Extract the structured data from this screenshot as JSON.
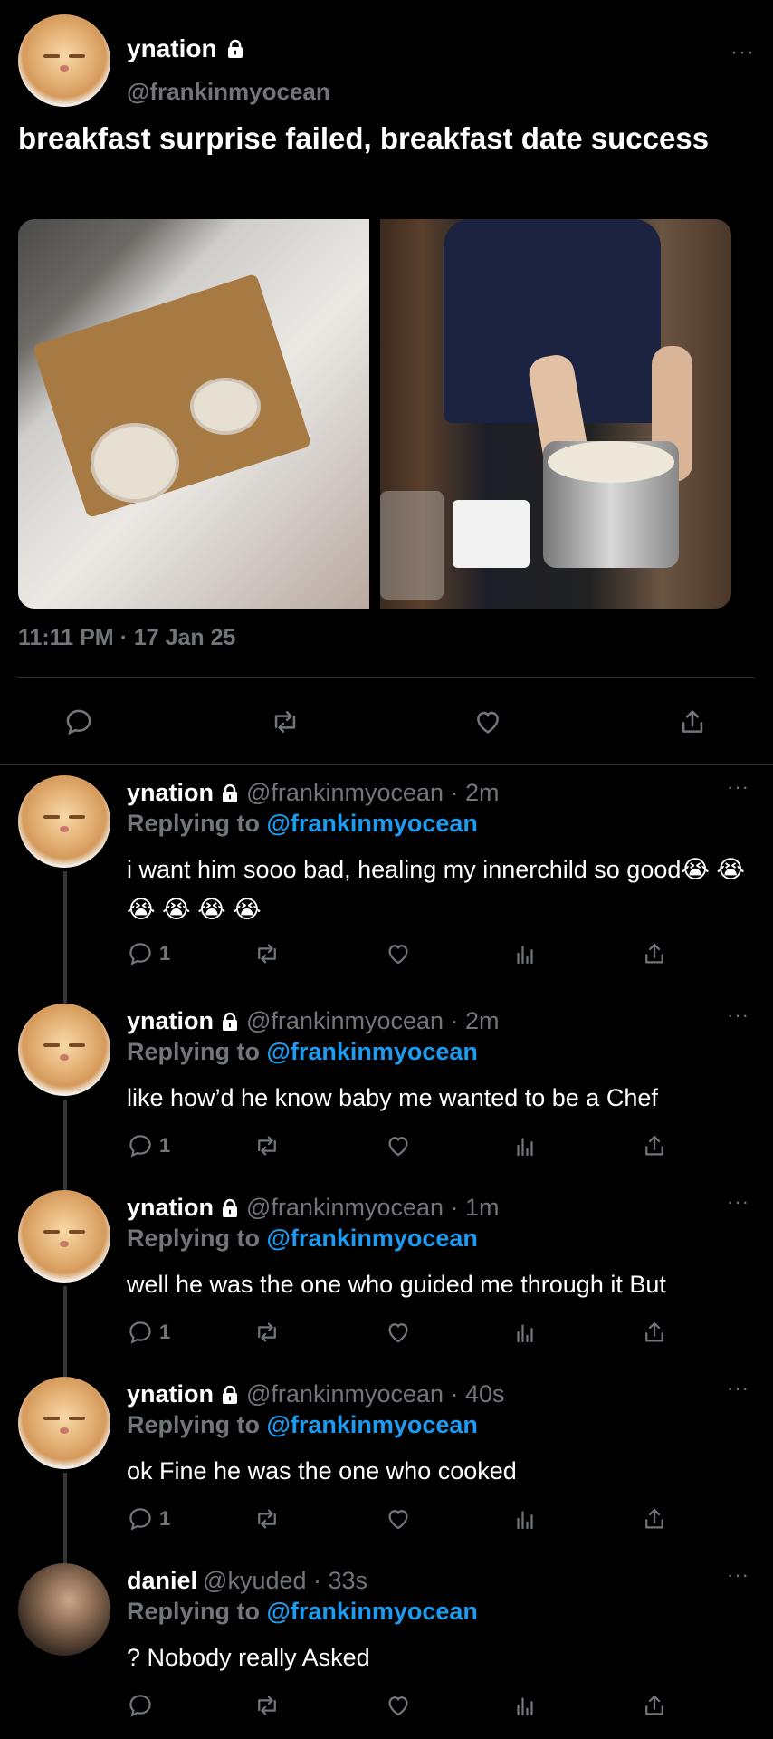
{
  "tweet": {
    "name": "ynation",
    "handle": "@frankinmyocean",
    "more": "···",
    "text": "breakfast surprise failed, breakfast date success",
    "timestamp": "11:11 PM · 17 Jan 25",
    "images": [
      "breakfast-tray-photo",
      "cooking-pot-photo"
    ]
  },
  "replies": [
    {
      "name": "ynation",
      "handle": "@frankinmyocean · 2m",
      "replying_prefix": "Replying to",
      "replying_to": "@frankinmyocean",
      "text": "i want him sooo bad, healing my innerchild so good😭 😭 😭 😭 😭 😭",
      "reply_count": "1",
      "more": "···"
    },
    {
      "name": "ynation",
      "handle": "@frankinmyocean · 2m",
      "replying_prefix": "Replying to",
      "replying_to": "@frankinmyocean",
      "text": "like how’d he know baby me wanted to be a Chef",
      "reply_count": "1",
      "more": "···"
    },
    {
      "name": "ynation",
      "handle": "@frankinmyocean · 1m",
      "replying_prefix": "Replying to",
      "replying_to": "@frankinmyocean",
      "text": "well he was the one who guided me through it But",
      "reply_count": "1",
      "more": "···"
    },
    {
      "name": "ynation",
      "handle": "@frankinmyocean · 40s",
      "replying_prefix": "Replying to",
      "replying_to": "@frankinmyocean",
      "text": "ok Fine he was the one who cooked",
      "reply_count": "1",
      "more": "···"
    },
    {
      "name": "daniel",
      "handle": "@kyuded · 33s",
      "replying_prefix": "Replying to",
      "replying_to": "@frankinmyocean",
      "text": "? Nobody really Asked",
      "reply_count": "",
      "more": "···"
    }
  ],
  "icons": {
    "reply": "speech-bubble-icon",
    "retweet": "retweet-icon",
    "like": "heart-icon",
    "views": "bar-chart-icon",
    "share": "share-icon",
    "lock": "lock-icon"
  },
  "colors": {
    "background": "#000000",
    "text": "#ffffff",
    "muted": "#71767b",
    "accent": "#1d9bf0"
  }
}
